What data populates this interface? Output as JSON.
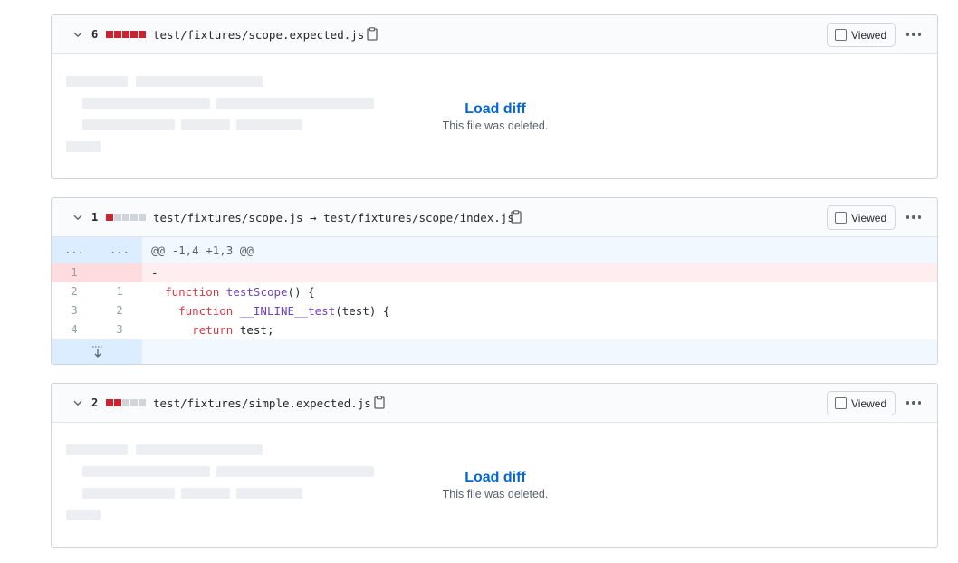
{
  "files": [
    {
      "count": "6",
      "stat": [
        "r",
        "r",
        "r",
        "r",
        "r"
      ],
      "path": "test/fixtures/scope.expected.js",
      "viewed_label": "Viewed",
      "load_label": "Load diff",
      "note": "This file was deleted."
    },
    {
      "count": "1",
      "stat": [
        "r",
        "g",
        "g",
        "g",
        "g"
      ],
      "path": "test/fixtures/scope.js → test/fixtures/scope/index.js",
      "viewed_label": "Viewed",
      "hunk": {
        "left_marker": "...",
        "right_marker": "...",
        "header": "@@ -1,4 +1,3 @@"
      },
      "lines": [
        {
          "type": "del",
          "old": "1",
          "new": "",
          "prefix": "-",
          "tokens": []
        },
        {
          "type": "ctx",
          "old": "2",
          "new": "1",
          "prefix": " ",
          "tokens": [
            {
              "t": " ",
              "c": ""
            },
            {
              "t": "function",
              "c": "kw"
            },
            {
              "t": " ",
              "c": ""
            },
            {
              "t": "testScope",
              "c": "fn"
            },
            {
              "t": "() {",
              "c": ""
            }
          ]
        },
        {
          "type": "ctx",
          "old": "3",
          "new": "2",
          "prefix": " ",
          "tokens": [
            {
              "t": "   ",
              "c": ""
            },
            {
              "t": "function",
              "c": "kw"
            },
            {
              "t": " ",
              "c": ""
            },
            {
              "t": "__INLINE__test",
              "c": "fn"
            },
            {
              "t": "(test) {",
              "c": ""
            }
          ]
        },
        {
          "type": "ctx",
          "old": "4",
          "new": "3",
          "prefix": " ",
          "tokens": [
            {
              "t": "     ",
              "c": ""
            },
            {
              "t": "return",
              "c": "kw"
            },
            {
              "t": " test;",
              "c": ""
            }
          ]
        }
      ]
    },
    {
      "count": "2",
      "stat": [
        "r",
        "r",
        "g",
        "g",
        "g"
      ],
      "path": "test/fixtures/simple.expected.js",
      "viewed_label": "Viewed",
      "load_label": "Load diff",
      "note": "This file was deleted."
    }
  ],
  "icons": {
    "chevron": "chevron-down-icon",
    "clipboard": "clipboard-icon",
    "kebab": "kebab-horizontal-icon",
    "expand": "unfold-down-icon"
  },
  "colors": {
    "link": "#0366d6",
    "deleted_bar": "#cb2431",
    "neutral_bar": "#d1d5da",
    "del_row": "#ffeef0",
    "hunk_row": "#f1f8ff"
  }
}
